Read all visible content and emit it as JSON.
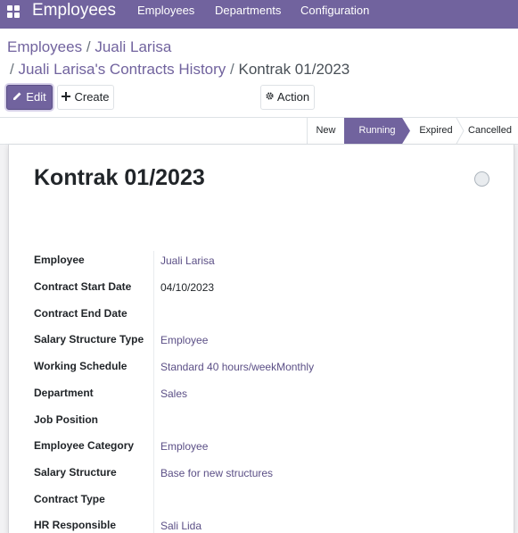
{
  "app": {
    "title": "Employees",
    "menu": [
      "Employees",
      "Departments",
      "Configuration"
    ]
  },
  "breadcrumb": {
    "root": "Employees",
    "employee": "Juali Larisa",
    "contracts": "Juali Larisa's Contracts History",
    "current": "Kontrak 01/2023",
    "separator": "/"
  },
  "toolbar": {
    "edit_label": "Edit",
    "create_label": "Create",
    "action_label": "Action"
  },
  "statusbar": {
    "stages": [
      "New",
      "Running",
      "Expired",
      "Cancelled"
    ],
    "active": "Running"
  },
  "record": {
    "title": "Kontrak 01/2023",
    "fields": [
      {
        "label": "Employee",
        "value": "Juali Larisa",
        "link": true
      },
      {
        "label": "Contract Start Date",
        "value": "04/10/2023",
        "link": false
      },
      {
        "label": "Contract End Date",
        "value": "",
        "link": false
      },
      {
        "label": "Salary Structure Type",
        "value": "Employee",
        "link": true
      },
      {
        "label": "Working Schedule",
        "value": "Standard 40 hours/weekMonthly",
        "link": true
      },
      {
        "label": "Department",
        "value": "Sales",
        "link": true
      },
      {
        "label": "Job Position",
        "value": "",
        "link": false
      },
      {
        "label": "Employee Category",
        "value": "Employee",
        "link": true
      },
      {
        "label": "Salary Structure",
        "value": "Base for new structures",
        "link": true
      },
      {
        "label": "Contract Type",
        "value": "",
        "link": false
      },
      {
        "label": "HR Responsible",
        "value": "Sali Lida",
        "link": true
      }
    ]
  },
  "colors": {
    "brand": "#71639e",
    "link": "#5b4f86"
  }
}
